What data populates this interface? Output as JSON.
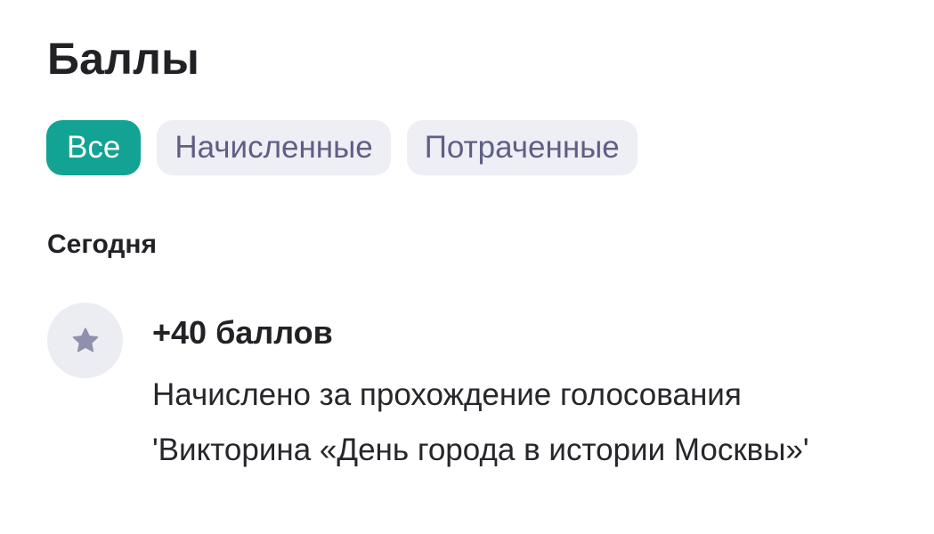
{
  "header": {
    "title": "Баллы"
  },
  "filters": {
    "tabs": [
      {
        "label": "Все",
        "active": true
      },
      {
        "label": "Начисленные",
        "active": false
      },
      {
        "label": "Потраченные",
        "active": false
      }
    ]
  },
  "history": {
    "section_label": "Сегодня",
    "items": [
      {
        "icon": "star-icon",
        "points": "+40 баллов",
        "description": "Начислено за прохождение голосования 'Викторина «День города в истории Москвы»'"
      }
    ]
  },
  "colors": {
    "accent": "#13a394",
    "tab_inactive_bg": "#eeeef5",
    "tab_inactive_text": "#5f5f85",
    "icon_bg": "#ececf3",
    "icon_fill": "#8f90ad"
  }
}
